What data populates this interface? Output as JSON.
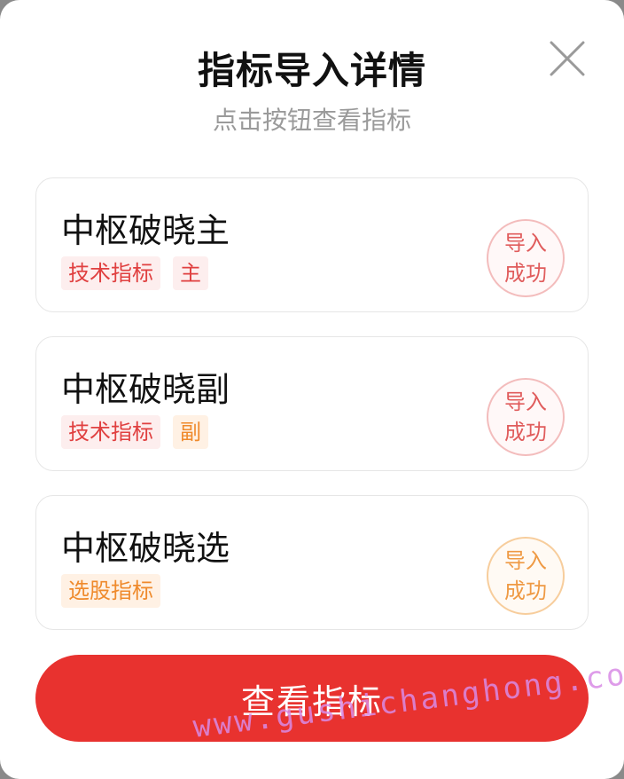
{
  "dialog": {
    "title": "指标导入详情",
    "subtitle": "点击按钮查看指标",
    "close_icon": "close-icon"
  },
  "items": [
    {
      "name": "中枢破晓主",
      "tags": [
        {
          "label": "技术指标",
          "color": "#e04040"
        },
        {
          "label": "主",
          "color": "#e04040"
        }
      ],
      "status_line1": "导入",
      "status_line2": "成功",
      "status_color": "#e05c5c"
    },
    {
      "name": "中枢破晓副",
      "tags": [
        {
          "label": "技术指标",
          "color": "#e04040"
        },
        {
          "label": "副",
          "color": "#ef8a2c"
        }
      ],
      "status_line1": "导入",
      "status_line2": "成功",
      "status_color": "#e05c5c"
    },
    {
      "name": "中枢破晓选",
      "tags": [
        {
          "label": "选股指标",
          "color": "#ef8a2c"
        }
      ],
      "status_line1": "导入",
      "status_line2": "成功",
      "status_color": "#ef9a44"
    }
  ],
  "action": {
    "label": "查看指标",
    "color": "#e8322f"
  },
  "watermark": "www.gushichanghong.com"
}
